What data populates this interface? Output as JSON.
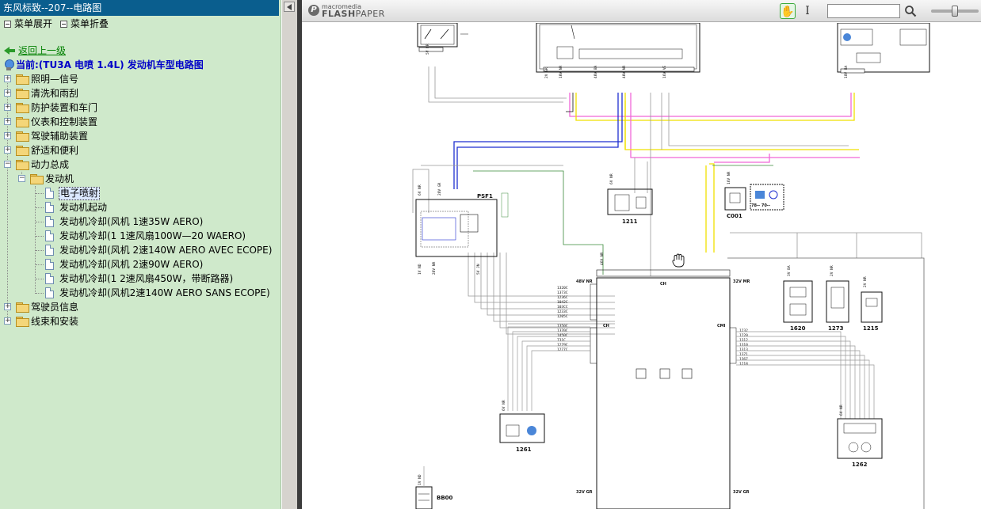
{
  "window": {
    "title": "东风标致--207--电路图"
  },
  "menu": {
    "expand_label": "菜单展开",
    "collapse_label": "菜单折叠"
  },
  "nav": {
    "back_label": "返回上一级",
    "current_label": "当前:(TU3A 电喷 1.4L) 发动机车型电路图"
  },
  "tree": {
    "top_items": [
      {
        "label": "照明—信号"
      },
      {
        "label": "清洗和雨刮"
      },
      {
        "label": "防护装置和车门"
      },
      {
        "label": "仪表和控制装置"
      },
      {
        "label": "驾驶辅助装置"
      },
      {
        "label": "舒适和便利"
      },
      {
        "label": "动力总成"
      }
    ],
    "engine_folder": {
      "label": "发动机"
    },
    "engine_children": [
      {
        "label": "电子喷射",
        "selected": true
      },
      {
        "label": "发动机起动"
      },
      {
        "label": "发动机冷却(风机 1速35W AERO)"
      },
      {
        "label": "发动机冷却(1 1速风扇100W—20 WAERO)"
      },
      {
        "label": "发动机冷却(风机 2速140W AERO AVEC ECOPE)"
      },
      {
        "label": "发动机冷却(风机 2速90W AERO)"
      },
      {
        "label": "发动机冷却(1 2速风扇450W，带断路器)"
      },
      {
        "label": "发动机冷却(风机2速140W AERO SANS ECOPE)"
      }
    ],
    "bottom_items": [
      {
        "label": "驾驶员信息"
      },
      {
        "label": "线束和安装"
      }
    ]
  },
  "viewer": {
    "logo_small": "macromedia",
    "logo_flash": "FLASH",
    "logo_paper": "PAPER",
    "hand_tool_icon": "hand-icon",
    "select_tool_icon": "text-cursor-icon",
    "search_value": "",
    "search_icon": "magnifier-icon",
    "zoom_level": 0.5
  },
  "diagram": {
    "components": {
      "psf1": "PSF1",
      "c1211": "1211",
      "c001": "C001",
      "c7870": "78-- 70--",
      "c1620": "1620",
      "c1273": "1273",
      "c1215": "1215",
      "c1261": "1261",
      "c1262": "1262",
      "bb00": "BB00",
      "ecu_ch_top": "CH",
      "ecu_ch_left": "CH",
      "ecu_cmi": "CMI",
      "ecu_48v": "48V NR",
      "ecu_32v_top": "32V MR",
      "ecu_32v_bl": "32V GR",
      "ecu_32v_br": "32V GR"
    },
    "connector_labels": {
      "top_a": [
        "2V GR",
        "10V NR",
        "40V BA",
        "16V VE",
        "18V BA",
        "5V NR",
        "40V NR"
      ],
      "psf1": [
        "6V NR",
        "28V GR",
        "1V ND",
        "28V NR",
        "5V JN"
      ],
      "mid": [
        "6V NR",
        "16V NR",
        "46V NR",
        "3V BA",
        "2V NR",
        "6V NR",
        "1V ND"
      ]
    },
    "wire_codes": {
      "ecu_left_top": [
        "1320C",
        "1373C",
        "1236C",
        "1042C",
        "103CC",
        "1233C",
        "1205C"
      ],
      "ecu_left_bottom": [
        "1350C",
        "1370C",
        "1450C",
        "731C",
        "1279C",
        "1277C"
      ],
      "ecu_right": [
        "1232",
        "1220",
        "1312",
        "1310",
        "1313",
        "1371",
        "1367",
        "1218"
      ]
    },
    "colors": {
      "blue": "#1f2fd0",
      "yellow": "#f0e000",
      "pink": "#f068d8",
      "green": "#3a8a3a",
      "gray": "#999999",
      "red": "#cc0000",
      "black": "#111111"
    }
  }
}
